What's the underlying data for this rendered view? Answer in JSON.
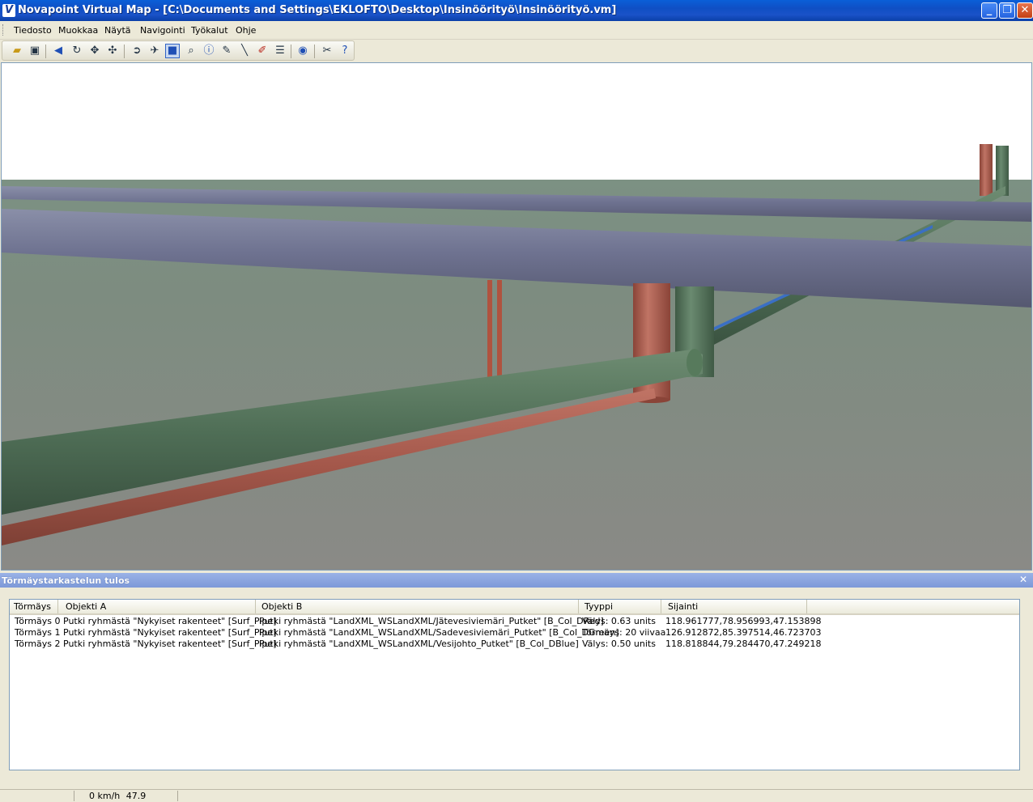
{
  "window": {
    "title": "Novapoint Virtual Map - [C:\\Documents and Settings\\EKLOFTO\\Desktop\\Insinöörityö\\Insinöörityö.vm]",
    "app_icon": "V"
  },
  "menu": {
    "items": [
      "Tiedosto",
      "Muokkaa",
      "Näytä",
      "Navigointi",
      "Työkalut",
      "Ohje"
    ]
  },
  "toolbar": {
    "buttons": [
      "open-icon",
      "save-image-icon",
      "back-icon",
      "rotate-icon",
      "pan-icon",
      "move-icon",
      "walk-icon",
      "fly-icon",
      "view-mode-icon",
      "zoom-icon",
      "info-icon",
      "measure-icon",
      "line-icon",
      "pen-icon",
      "layers-icon",
      "collision-icon",
      "tools-icon",
      "help-icon"
    ],
    "active": "view-mode-icon"
  },
  "viewport": {
    "colors": {
      "sky": "#ffffff",
      "ground_far": "#7c9183",
      "ground_near": "#8a8a86",
      "surface_pipe": "#6b6f8a",
      "water_green": "#4f6e56",
      "sewer_red": "#a3574a",
      "water_blue": "#3a6fc4"
    }
  },
  "panel": {
    "title": "Törmäystarkastelun tulos",
    "columns": [
      "Törmäys",
      "Objekti A",
      "Objekti B",
      "Tyyppi",
      "Sijainti"
    ],
    "rows": [
      [
        "Törmäys 0",
        "Putki ryhmästä \"Nykyiset rakenteet\" [Surf_Pipe]",
        "Putki ryhmästä \"LandXML_WSLandXML/Jätevesiviemäri_Putket\" [B_Col_DRed]",
        "Välys: 0.63 units",
        "118.961777,78.956993,47.153898"
      ],
      [
        "Törmäys 1",
        "Putki ryhmästä \"Nykyiset rakenteet\" [Surf_Pipe]",
        "Putki ryhmästä \"LandXML_WSLandXML/Sadevesiviemäri_Putket\" [B_Col_DGreen]",
        "Törmäys: 20 viivaa",
        "126.912872,85.397514,46.723703"
      ],
      [
        "Törmäys 2",
        "Putki ryhmästä \"Nykyiset rakenteet\" [Surf_Pipe]",
        "Putki ryhmästä \"LandXML_WSLandXML/Vesijohto_Putket\" [B_Col_DBlue]",
        "Välys: 0.50 units",
        "118.818844,79.284470,47.249218"
      ]
    ]
  },
  "status": {
    "speed": "0 km/h",
    "value": "47.9"
  }
}
